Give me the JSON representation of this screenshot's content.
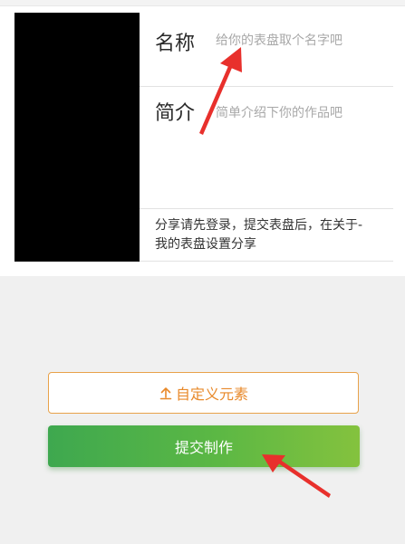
{
  "form": {
    "name_label": "名称",
    "name_placeholder": "给你的表盘取个名字吧",
    "intro_label": "简介",
    "intro_placeholder": "简单介绍下你的作品吧",
    "share_note": "分享请先登录，提交表盘后，在关于-我的表盘设置分享"
  },
  "actions": {
    "custom_element_label": "自定义元素",
    "submit_label": "提交制作"
  },
  "icons": {
    "custom_element": "upload-icon"
  },
  "colors": {
    "accent_orange": "#e8892a",
    "primary_green": "#5cb844",
    "annotation_red": "#e8302c"
  }
}
